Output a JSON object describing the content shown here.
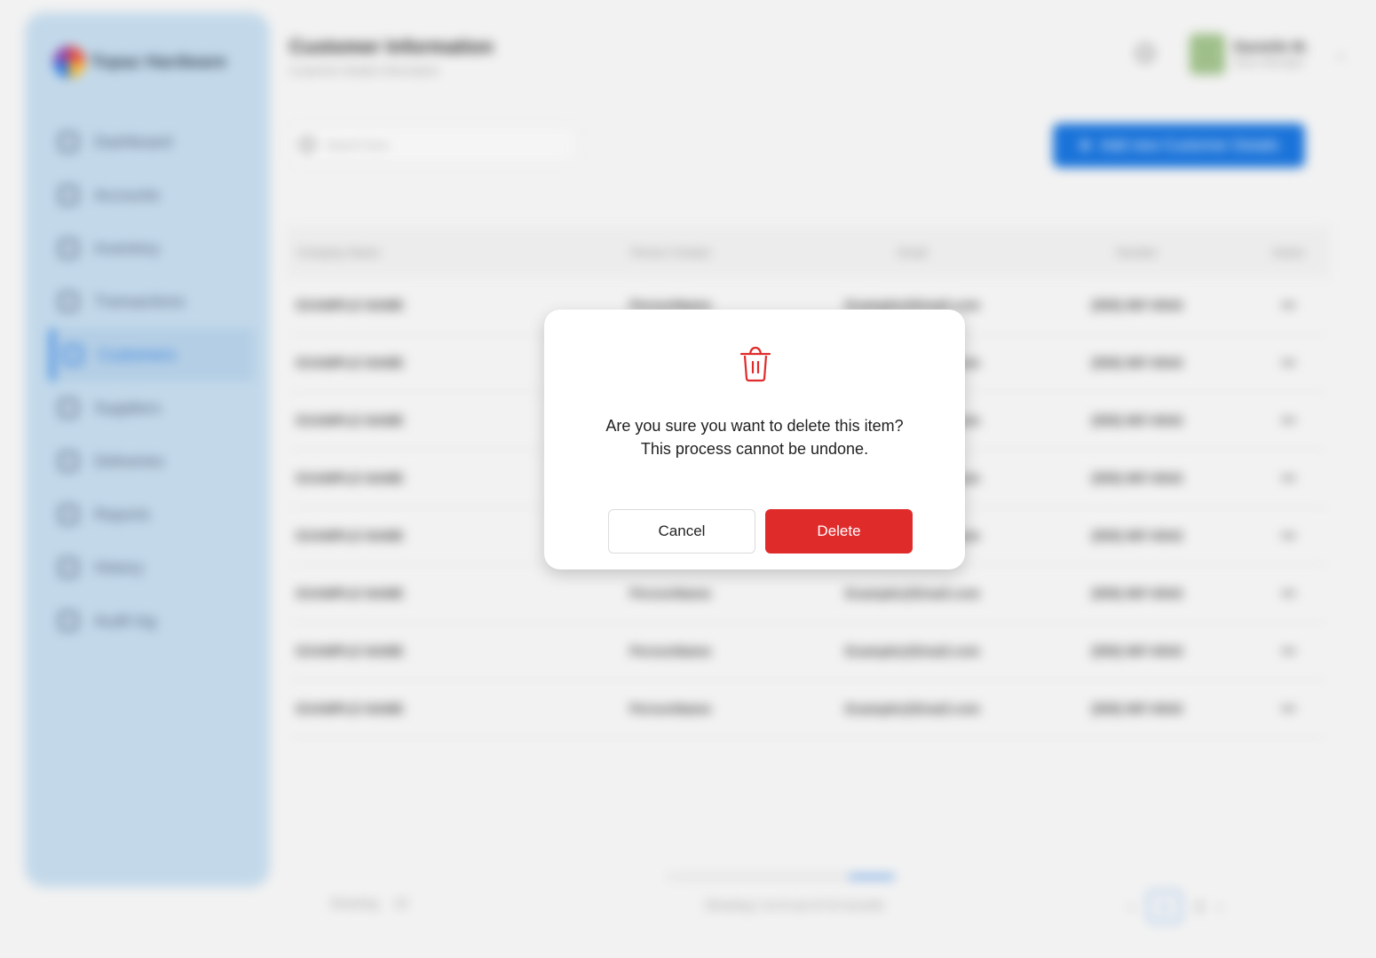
{
  "app": {
    "brand_name": "Topaz Hardware"
  },
  "sidebar": {
    "items": [
      {
        "label": "Dashboard",
        "active": false
      },
      {
        "label": "Accounts",
        "active": false
      },
      {
        "label": "Inventory",
        "active": false
      },
      {
        "label": "Transactions",
        "active": false
      },
      {
        "label": "Customers",
        "active": true
      },
      {
        "label": "Suppliers",
        "active": false
      },
      {
        "label": "Deliveries",
        "active": false
      },
      {
        "label": "Reports",
        "active": false
      },
      {
        "label": "History",
        "active": false
      },
      {
        "label": "Audit log",
        "active": false
      }
    ]
  },
  "header": {
    "title": "Customer Information",
    "subtitle": "Customer Details Information",
    "user_name": "Danielle M.",
    "user_role": "Store Manager"
  },
  "toolbar": {
    "search_placeholder": "Search here",
    "add_button_label": "Add new Customer Details"
  },
  "table": {
    "columns": [
      "Company Name",
      "Person Contact",
      "Email",
      "Number",
      "Action"
    ],
    "rows": [
      [
        "EXAMPLE NAME",
        "PersonName",
        "Example@Email.com",
        "(555) 987-6543",
        "•••"
      ],
      [
        "EXAMPLE NAME",
        "PersonName",
        "Example@Email.com",
        "(555) 987-6543",
        "•••"
      ],
      [
        "EXAMPLE NAME",
        "PersonName",
        "Example@Email.com",
        "(555) 987-6543",
        "•••"
      ],
      [
        "EXAMPLE NAME",
        "PersonName",
        "Example@Email.com",
        "(555) 987-6543",
        "•••"
      ],
      [
        "EXAMPLE NAME",
        "PersonName",
        "Example@Email.com",
        "(555) 987-6543",
        "•••"
      ],
      [
        "EXAMPLE NAME",
        "PersonName",
        "Example@Email.com",
        "(555) 987-6543",
        "•••"
      ],
      [
        "EXAMPLE NAME",
        "PersonName",
        "Example@Email.com",
        "(555) 987-6543",
        "•••"
      ],
      [
        "EXAMPLE NAME",
        "PersonName",
        "Example@Email.com",
        "(555) 987-6543",
        "•••"
      ]
    ]
  },
  "footer": {
    "showing_label": "Showing",
    "page_size": "10",
    "summary": "Showing 1 to 8 out of 10 records",
    "pages": [
      "1",
      "2"
    ],
    "current_page": "1",
    "prev": "‹",
    "next": "›"
  },
  "modal": {
    "icon": "trash-icon",
    "line1": "Are you sure you want to delete this item?",
    "line2": "This process cannot be undone.",
    "cancel_label": "Cancel",
    "delete_label": "Delete"
  },
  "colors": {
    "accent": "#1a73d9",
    "danger": "#e02b2b",
    "sidebar_bg": "#c3d9ea"
  }
}
